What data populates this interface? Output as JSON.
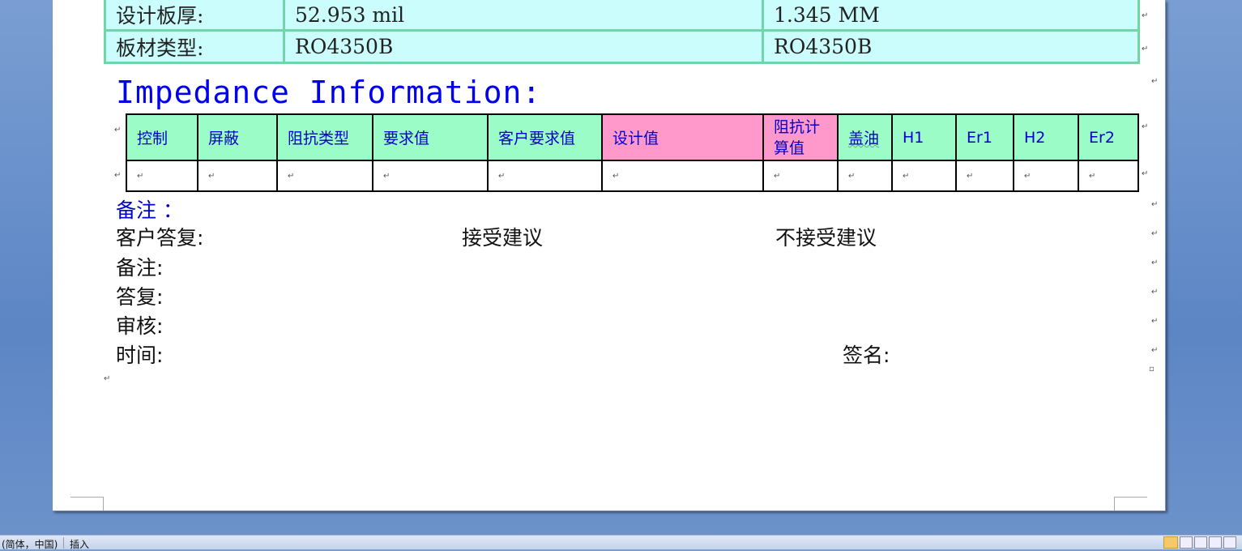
{
  "board": {
    "rows": [
      {
        "label": "设计板厚:",
        "value_mil": "52.953 mil",
        "value_mm": "1.345 MM"
      },
      {
        "label": "板材类型:",
        "value_mil": "RO4350B",
        "value_mm": "RO4350B"
      }
    ]
  },
  "heading": "Impedance Information:",
  "impedance_table": {
    "headers": [
      "控制",
      "屏蔽",
      "阻抗类型",
      "要求值",
      "客户要求值",
      "设计值",
      "阻抗计算值",
      "盖油",
      "H1",
      "Er1",
      "H2",
      "Er2"
    ],
    "calc_header_line1": "阻抗计",
    "calc_header_line2": "算值"
  },
  "notes": {
    "remark_blue": "备注 ：",
    "customer_reply": "客户答复:",
    "accept": "接受建议",
    "reject": "不接受建议",
    "remark": "备注:",
    "reply": "答复:",
    "review": "审核:",
    "time": "时间:",
    "sign": "签名:"
  },
  "status_bar": {
    "language": "(简体，中国)",
    "mode": "插入"
  },
  "colors": {
    "info_bg": "#ccfdfd",
    "info_border": "#73d3a9",
    "header_green": "#9cfcc8",
    "header_pink": "#ff99cc",
    "heading_blue": "#0000ee"
  }
}
